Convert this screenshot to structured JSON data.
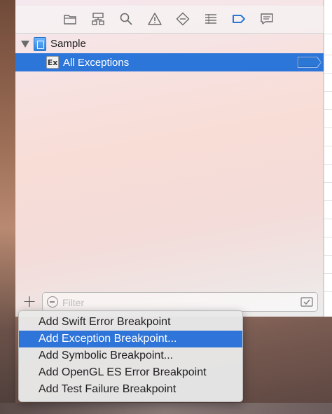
{
  "navigator": {
    "tree": {
      "project_name": "Sample",
      "items": [
        {
          "icon": "exception-breakpoint-icon",
          "icon_text": "Ex",
          "label": "All Exceptions",
          "selected": true
        }
      ]
    }
  },
  "footer": {
    "add_label": "+",
    "filter_placeholder": "Filter"
  },
  "context_menu": {
    "items": [
      {
        "label": "Add Swift Error Breakpoint"
      },
      {
        "label": "Add Exception Breakpoint...",
        "highlighted": true
      },
      {
        "label": "Add Symbolic Breakpoint..."
      },
      {
        "label": "Add OpenGL ES Error Breakpoint"
      },
      {
        "label": "Add Test Failure Breakpoint"
      }
    ]
  },
  "toolbar_icons": [
    "folder-icon",
    "hierarchy-icon",
    "search-icon",
    "warning-icon",
    "test-diamond-icon",
    "debug-list-icon",
    "breakpoint-icon",
    "report-bubble-icon"
  ],
  "colors": {
    "selection": "#2d76d9",
    "menu_highlight": "#2f74d8",
    "active_icon": "#2b77d6"
  }
}
